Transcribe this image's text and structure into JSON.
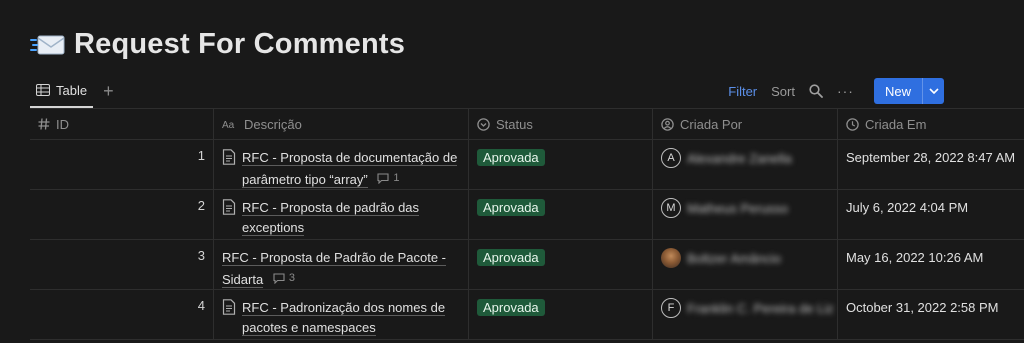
{
  "page": {
    "title": "Request For Comments",
    "emoji": "envelope-incoming-icon"
  },
  "viewbar": {
    "tab_label": "Table",
    "add_view": "+",
    "filter_label": "Filter",
    "sort_label": "Sort",
    "more_label": "···",
    "new_label": "New"
  },
  "table": {
    "columns": [
      {
        "label": "ID",
        "icon": "hash-icon"
      },
      {
        "label": "Descrição",
        "icon": "text-icon"
      },
      {
        "label": "Status",
        "icon": "status-icon"
      },
      {
        "label": "Criada Por",
        "icon": "person-icon"
      },
      {
        "label": "Criada Em",
        "icon": "clock-icon"
      }
    ],
    "rows": [
      {
        "id": "1",
        "desc_line1": "RFC - Proposta de documentação de",
        "desc_line2": "parâmetro tipo “array”",
        "has_doc_icon": true,
        "comments": "1",
        "status": "Aprovada",
        "avatar_letter": "A",
        "creator": "Alexandre Zanella",
        "created": "September 28, 2022 8:47 AM"
      },
      {
        "id": "2",
        "desc_line1": "RFC - Proposta de padrão das",
        "desc_line2": "exceptions",
        "has_doc_icon": true,
        "comments": "",
        "status": "Aprovada",
        "avatar_letter": "M",
        "creator": "Matheus Perusso",
        "created": "July 6, 2022 4:04 PM"
      },
      {
        "id": "3",
        "desc_line1": "RFC - Proposta de Padrão de Pacote -",
        "desc_line2": "Sidarta",
        "has_doc_icon": false,
        "comments": "3",
        "status": "Aprovada",
        "avatar_letter": "",
        "creator": "Boltzer Amâncio",
        "created": "May 16, 2022 10:26 AM"
      },
      {
        "id": "4",
        "desc_line1": "RFC - Padronização dos nomes de",
        "desc_line2": "pacotes e namespaces",
        "has_doc_icon": true,
        "comments": "",
        "status": "Aprovada",
        "avatar_letter": "F",
        "creator": "Franklin C. Pereira de Liz",
        "created": "October 31, 2022 2:58 PM"
      }
    ]
  },
  "colors": {
    "background": "#191919",
    "accent": "#2f6fe0",
    "status_green": "#1f5a3a",
    "filter_blue": "#5b8fe8"
  }
}
